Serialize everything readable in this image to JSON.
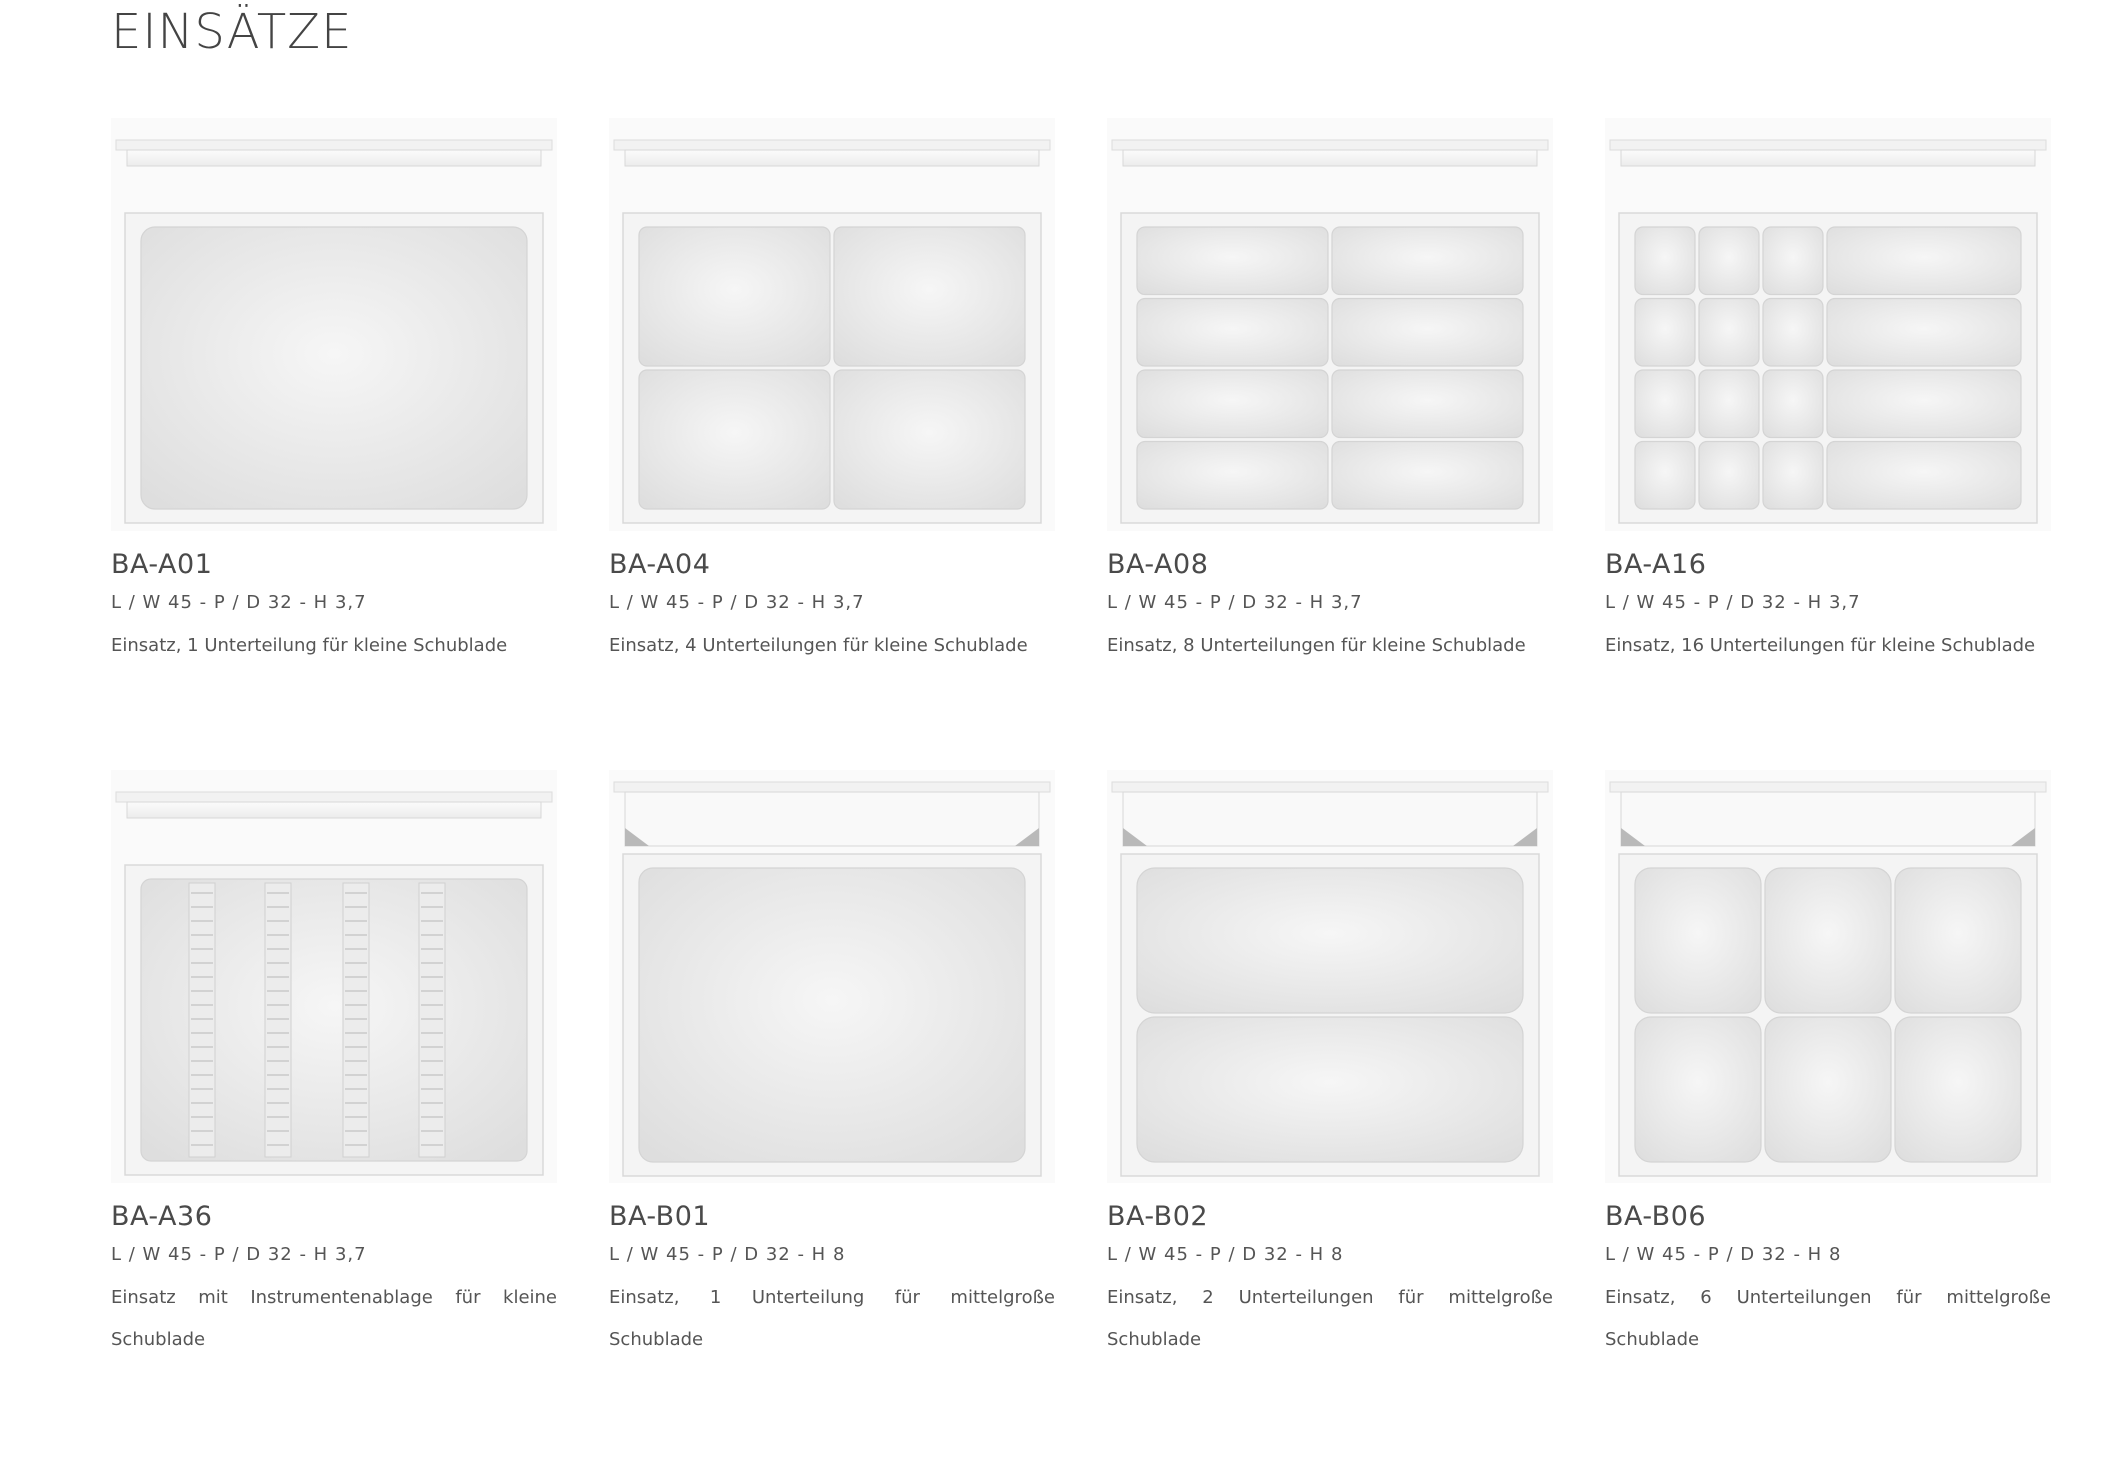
{
  "page": {
    "title": "EINSÄTZE"
  },
  "products": [
    {
      "code": "BA-A01",
      "dims": "L / W 45 - P / D 32 - H 3,7",
      "desc": "Einsatz, 1 Unterteilung für kleine Schublade",
      "drawer": "small",
      "layout": "single"
    },
    {
      "code": "BA-A04",
      "dims": "L / W 45 - P / D 32 - H 3,7",
      "desc": "Einsatz, 4 Unterteilungen für kleine Schublade",
      "drawer": "small",
      "layout": "grid-2x2"
    },
    {
      "code": "BA-A08",
      "dims": "L / W 45 - P / D 32 - H 3,7",
      "desc": "Einsatz, 8 Unterteilungen für kleine Schublade",
      "drawer": "small",
      "layout": "grid-2x4"
    },
    {
      "code": "BA-A16",
      "dims": "L / W 45 - P / D 32 - H 3,7",
      "desc": "Einsatz, 16 Unterteilungen für kleine Schublade",
      "drawer": "small",
      "layout": "grid-16"
    },
    {
      "code": "BA-A36",
      "dims": "L / W 45 - P / D 32 - H 3,7",
      "desc": "Einsatz mit Instrumentenablage für kleine Schublade",
      "drawer": "small",
      "layout": "instrument-rails"
    },
    {
      "code": "BA-B01",
      "dims": "L / W 45 - P / D 32 - H 8",
      "desc": "Einsatz, 1 Unterteilung für mittelgroße Schublade",
      "drawer": "medium",
      "layout": "single"
    },
    {
      "code": "BA-B02",
      "dims": "L / W 45 - P / D 32 - H 8",
      "desc": "Einsatz, 2 Unterteilungen für mittelgroße Schublade",
      "drawer": "medium",
      "layout": "rows-2"
    },
    {
      "code": "BA-B06",
      "dims": "L / W 45 - P / D 32 - H 8",
      "desc": "Einsatz, 6 Unterteilungen für mittelgroße Schublade",
      "drawer": "medium",
      "layout": "grid-3x2"
    }
  ]
}
